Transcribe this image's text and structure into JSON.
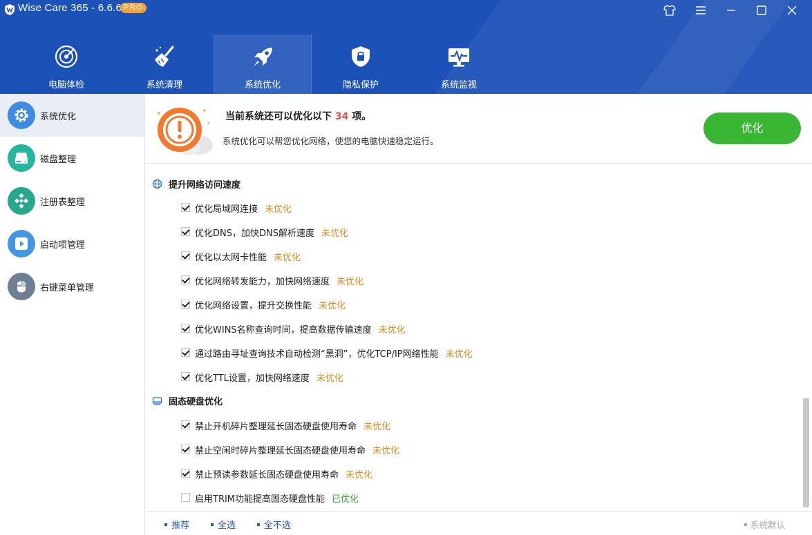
{
  "app": {
    "title": "Wise Care 365 - 6.6.6",
    "badge": "PRO",
    "colors": {
      "header": "#1c52b8",
      "accent_green": "#3bb534",
      "pending": "#e08a1e",
      "done": "#39a538",
      "count_red": "#e8504b"
    }
  },
  "window_controls": [
    "shirt-icon",
    "menu-icon",
    "minimize-icon",
    "maximize-icon",
    "close-icon"
  ],
  "nav": {
    "items": [
      {
        "label": "电脑体检",
        "icon": "radar-icon"
      },
      {
        "label": "系统清理",
        "icon": "broom-icon"
      },
      {
        "label": "系统优化",
        "icon": "rocket-icon",
        "active": true
      },
      {
        "label": "隐私保护",
        "icon": "shield-lock-icon"
      },
      {
        "label": "系统监视",
        "icon": "monitor-pulse-icon"
      }
    ]
  },
  "sidebar": {
    "items": [
      {
        "label": "系统优化",
        "icon": "gear-icon",
        "active": true
      },
      {
        "label": "磁盘整理",
        "icon": "disk-icon"
      },
      {
        "label": "注册表整理",
        "icon": "registry-icon"
      },
      {
        "label": "启动项管理",
        "icon": "play-icon"
      },
      {
        "label": "右键菜单管理",
        "icon": "mouse-icon"
      }
    ]
  },
  "summary": {
    "title_prefix": "当前系统还可以优化以下",
    "count": "34",
    "title_suffix": "项。",
    "description": "系统优化可以帮您优化网络，使您的电脑快速稳定运行。",
    "button_label": "优化"
  },
  "sections": [
    {
      "title": "提升网络访问速度",
      "icon": "globe-icon",
      "items": [
        {
          "label": "优化局域网连接",
          "status": "未优化",
          "checked": true
        },
        {
          "label": "优化DNS，加快DNS解析速度",
          "status": "未优化",
          "checked": true
        },
        {
          "label": "优化以太网卡性能",
          "status": "未优化",
          "checked": true
        },
        {
          "label": "优化网络转发能力，加快网络速度",
          "status": "未优化",
          "checked": true
        },
        {
          "label": "优化网络设置，提升交换性能",
          "status": "未优化",
          "checked": true
        },
        {
          "label": "优化WINS名称查询时间，提高数据传输速度",
          "status": "未优化",
          "checked": true
        },
        {
          "label": "通过路由寻址查询技术自动检测“黑洞”，优化TCP/IP网络性能",
          "status": "未优化",
          "checked": true
        },
        {
          "label": "优化TTL设置，加快网络速度",
          "status": "未优化",
          "checked": true
        }
      ]
    },
    {
      "title": "固态硬盘优化",
      "icon": "ssd-icon",
      "items": [
        {
          "label": "禁止开机碎片整理延长固态硬盘使用寿命",
          "status": "未优化",
          "checked": true
        },
        {
          "label": "禁止空闲时碎片整理延长固态硬盘使用寿命",
          "status": "未优化",
          "checked": true
        },
        {
          "label": "禁止预读参数延长固态硬盘使用寿命",
          "status": "未优化",
          "checked": true
        },
        {
          "label": "启用TRIM功能提高固态硬盘性能",
          "status": "已优化",
          "checked": false
        }
      ]
    }
  ],
  "footer": {
    "recommend": "推荐",
    "select_all": "全选",
    "select_none": "全不选",
    "system_default": "系统默认"
  }
}
